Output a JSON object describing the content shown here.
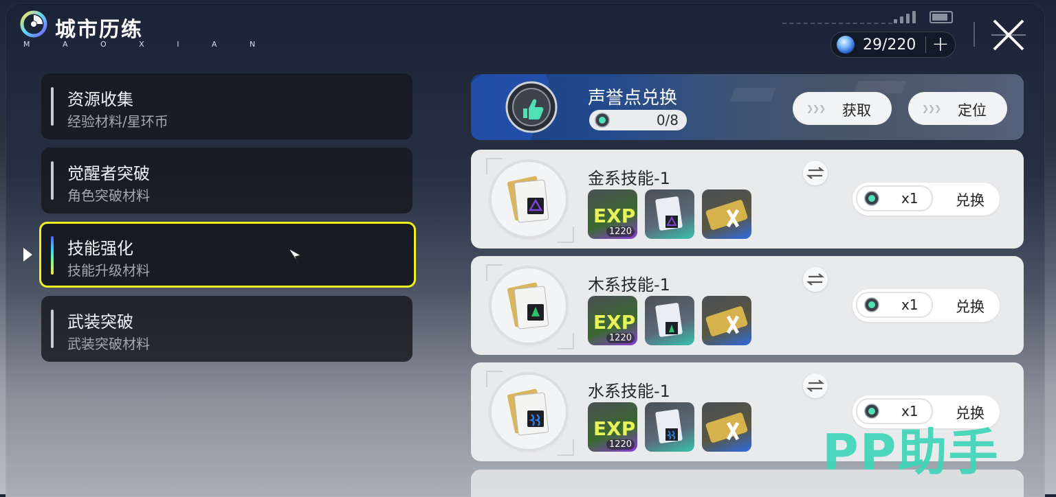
{
  "header": {
    "title": "城市历练",
    "subtitle": "M A O X I A N",
    "energy": "29/220",
    "energy_plus": "+"
  },
  "menu": [
    {
      "title": "资源收集",
      "subtitle": "经验材料/星环币"
    },
    {
      "title": "觉醒者突破",
      "subtitle": "角色突破材料"
    },
    {
      "title": "技能强化",
      "subtitle": "技能升级材料",
      "active": true
    },
    {
      "title": "武装突破",
      "subtitle": "武装突破材料"
    }
  ],
  "banner": {
    "title": "声誉点兑换",
    "progress": "0/8",
    "get_label": "获取",
    "locate_label": "定位",
    "chevrons": "❯❯❯"
  },
  "cards": [
    {
      "name": "金系技能-1",
      "exp_count": "1220",
      "qty": "x1",
      "exchange": "兑换",
      "element_color": "#7c45d8"
    },
    {
      "name": "木系技能-1",
      "exp_count": "1220",
      "qty": "x1",
      "exchange": "兑换",
      "element_color": "#2fbf6a"
    },
    {
      "name": "水系技能-1",
      "exp_count": "1220",
      "qty": "x1",
      "exchange": "兑换",
      "element_color": "#2f7ce0"
    }
  ],
  "watermark": "PP助手",
  "colors": {
    "active_border": "#eef01f",
    "accent_teal": "#3fd6b8"
  }
}
